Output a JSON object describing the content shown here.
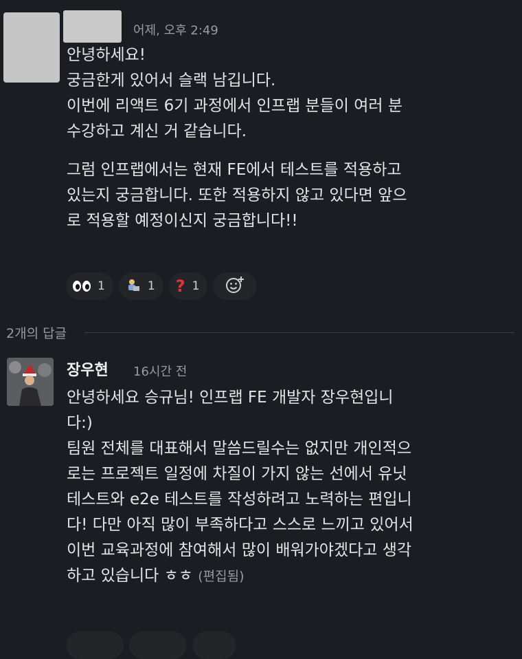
{
  "message": {
    "timestamp": "어제, 오후 2:49",
    "paragraph1": [
      "안녕하세요!",
      "궁금한게 있어서 슬랙 남깁니다.",
      "이번에 리액트 6기 과정에서 인프랩 분들이 여러 분",
      "수강하고 계신 거 같습니다."
    ],
    "paragraph2": [
      "그럼 인프랩에서는 현재 FE에서 테스트를 적용하고",
      "있는지 궁금합니다. 또한 적용하지 않고 있다면 앞으",
      "로 적용할 예정이신지 궁금합니다!!"
    ],
    "reactions": [
      {
        "emoji": "eyes-icon",
        "count": "1"
      },
      {
        "emoji": "person-at-laptop-icon",
        "count": "1"
      },
      {
        "emoji": "question-icon",
        "count": "1"
      }
    ]
  },
  "thread": {
    "label": "2개의 답글"
  },
  "reply": {
    "author": "장우현",
    "timestamp": "16시간 전",
    "lines": [
      "안녕하세요 승규님! 인프랩 FE 개발자 장우현입니",
      "다:)",
      "팀원 전체를 대표해서 말씀드릴수는 없지만 개인적으",
      "로는 프로젝트 일정에 차질이 가지 않는 선에서 유닛",
      "테스트와 e2e 테스트를 작성하려고 노력하는 편입니",
      "다! 다만 아직 많이 부족하다고 스스로 느끼고 있어서",
      "이번 교육과정에 참여해서 많이 배워가야겠다고 생각"
    ],
    "last_line": "하고 있습니다 ㅎㅎ",
    "edited": "(편집됨)"
  },
  "colors": {
    "background": "#1a1d21",
    "text": "#e3e4e5",
    "muted": "#9a9b9d",
    "reaction_bg": "#232529"
  }
}
